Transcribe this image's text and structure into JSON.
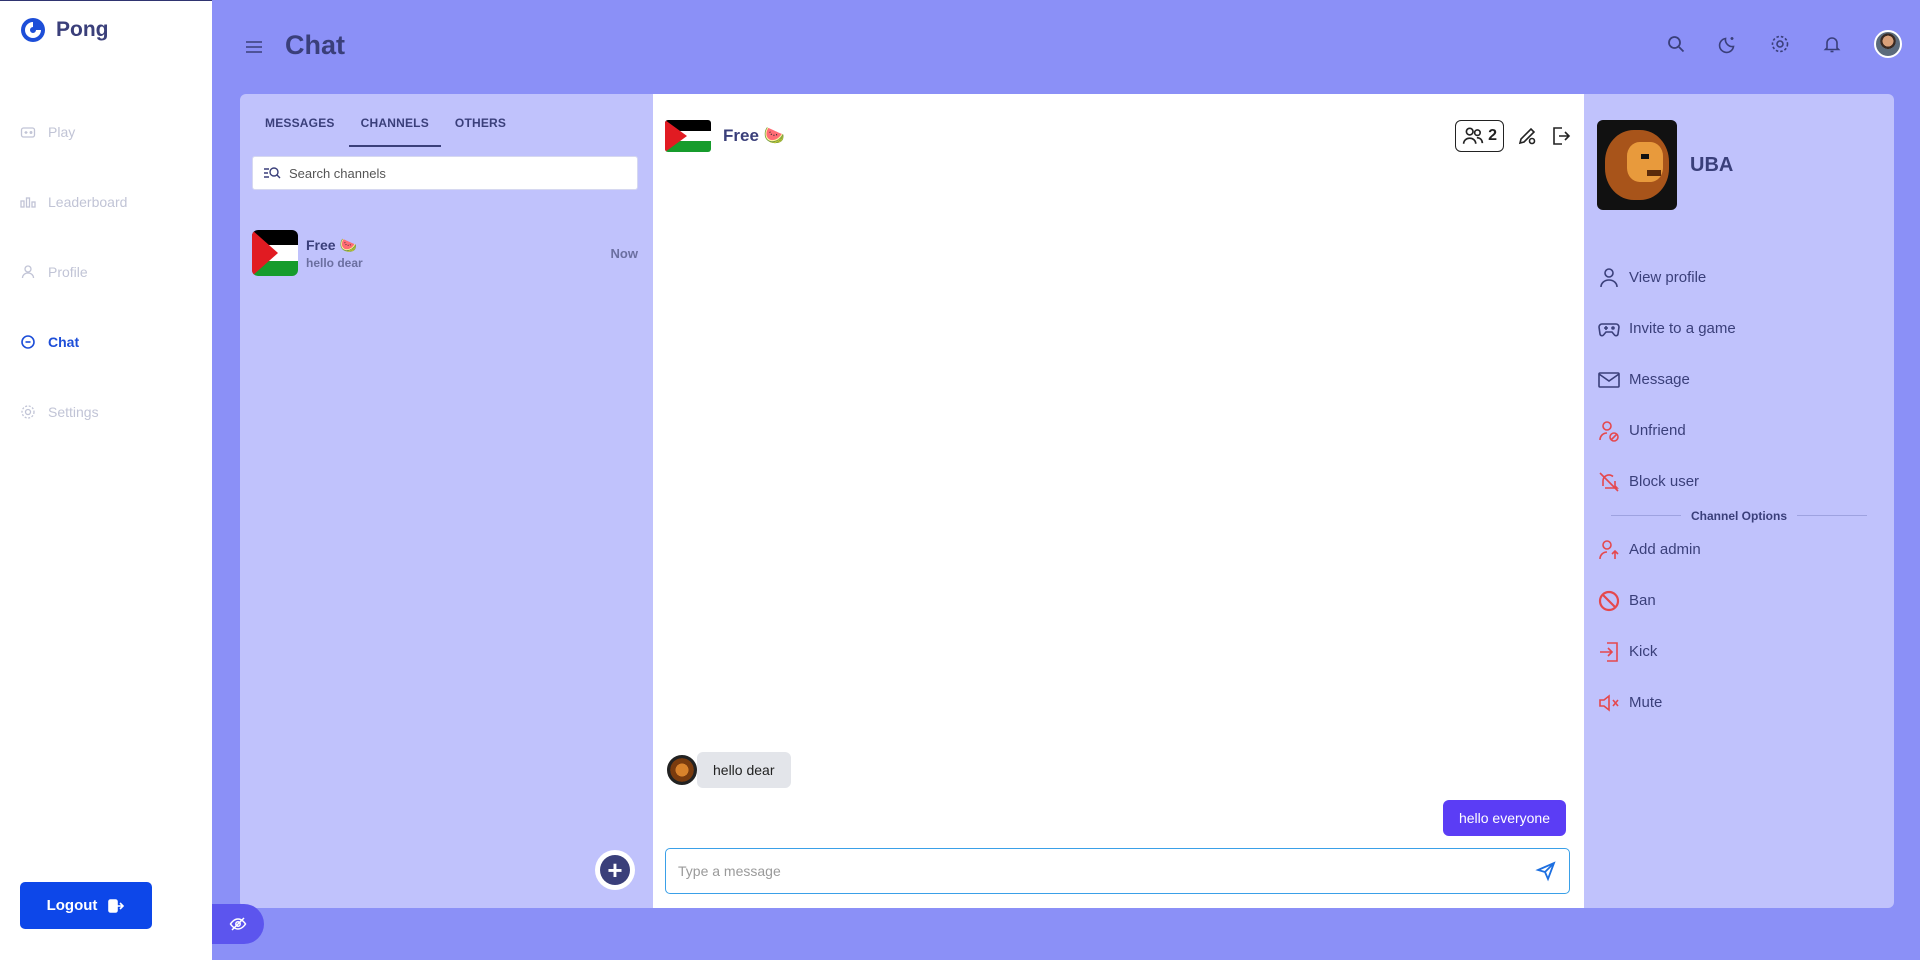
{
  "brand": {
    "name": "Pong"
  },
  "sidebar": {
    "items": [
      {
        "label": "Play",
        "icon": "gamepad-icon",
        "active": false
      },
      {
        "label": "Leaderboard",
        "icon": "leaderboard-icon",
        "active": false
      },
      {
        "label": "Profile",
        "icon": "user-icon",
        "active": false
      },
      {
        "label": "Chat",
        "icon": "chat-icon",
        "active": true
      },
      {
        "label": "Settings",
        "icon": "gear-icon",
        "active": false
      }
    ],
    "logout_label": "Logout"
  },
  "header": {
    "title": "Chat",
    "icons": [
      "search-icon",
      "moon-icon",
      "gear-icon",
      "bell-icon",
      "avatar"
    ]
  },
  "channels_panel": {
    "tabs": [
      {
        "label": "MESSAGES",
        "active": false
      },
      {
        "label": "CHANNELS",
        "active": true
      },
      {
        "label": "OTHERS",
        "active": false
      }
    ],
    "search": {
      "placeholder": "Search channels"
    },
    "channels": [
      {
        "name": "Free 🍉",
        "last_message": "hello dear",
        "time": "Now"
      }
    ]
  },
  "chat": {
    "title": "Free 🍉",
    "member_count": "2",
    "messages": [
      {
        "direction": "incoming",
        "text": "hello dear"
      },
      {
        "direction": "outgoing",
        "text": "hello everyone"
      }
    ],
    "composer": {
      "placeholder": "Type a message"
    }
  },
  "profile_panel": {
    "name": "UBA",
    "actions": [
      {
        "label": "View profile",
        "icon": "user-icon"
      },
      {
        "label": "Invite to a game",
        "icon": "gamepad-icon"
      },
      {
        "label": "Message",
        "icon": "mail-icon"
      },
      {
        "label": "Unfriend",
        "icon": "user-remove-icon"
      },
      {
        "label": "Block user",
        "icon": "bell-off-icon"
      }
    ],
    "section_title": "Channel Options",
    "channel_actions": [
      {
        "label": "Add admin",
        "icon": "user-up-icon"
      },
      {
        "label": "Ban",
        "icon": "ban-icon"
      },
      {
        "label": "Kick",
        "icon": "kick-icon"
      },
      {
        "label": "Mute",
        "icon": "mute-icon"
      }
    ]
  },
  "colors": {
    "background": "#8b90f7",
    "panel": "#c0c2fc",
    "accent": "#0d47e9",
    "outgoing_bubble": "#5b3df5",
    "danger_icon": "#e5484d"
  }
}
